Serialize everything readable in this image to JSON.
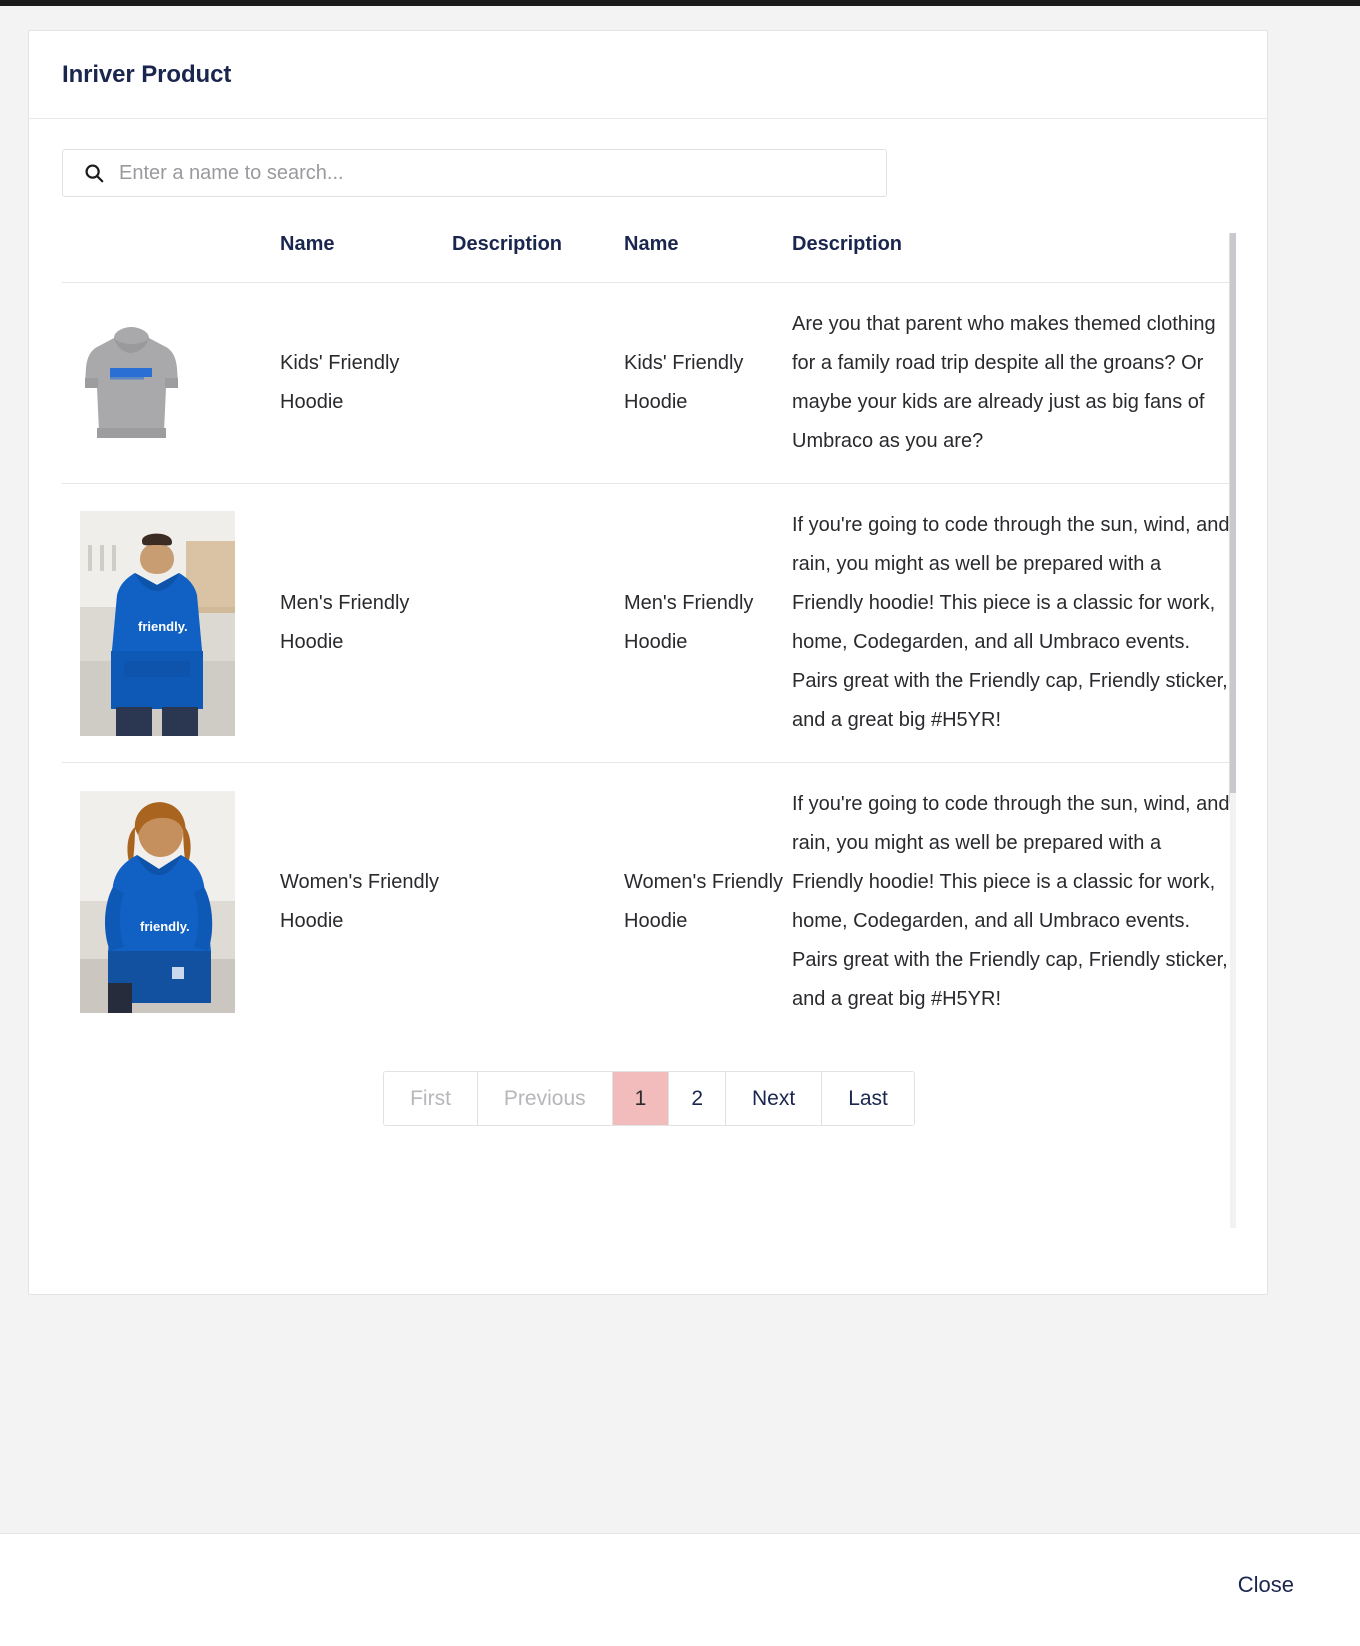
{
  "window": {
    "title": "Inriver Product"
  },
  "search": {
    "placeholder": "Enter a name to search...",
    "value": "",
    "icon": "search-icon"
  },
  "table": {
    "headers": [
      "Name",
      "Description",
      "Name",
      "Description"
    ],
    "rows": [
      {
        "image_alt": "Kids' Friendly Hoodie",
        "name1": "Kids' Friendly Hoodie",
        "description1": "",
        "name2": "Kids' Friendly Hoodie",
        "description2": "Are you that parent who makes themed clothing for a family road trip despite all the groans? Or maybe your kids are already just as big fans of Umbraco as you are?"
      },
      {
        "image_alt": "Men's Friendly Hoodie",
        "name1": "Men's Friendly Hoodie",
        "description1": "",
        "name2": "Men's Friendly Hoodie",
        "description2": "If you're going to code through the sun, wind, and rain, you might as well be prepared with a Friendly hoodie! This piece is a classic for work, home, Codegarden, and all Umbraco events. Pairs great with the Friendly cap, Friendly sticker, and a great big #H5YR!"
      },
      {
        "image_alt": "Women's Friendly Hoodie",
        "name1": "Women's Friendly Hoodie",
        "description1": "",
        "name2": "Women's Friendly Hoodie",
        "description2": "If you're going to code through the sun, wind, and rain, you might as well be prepared with a Friendly hoodie! This piece is a classic for work, home, Codegarden, and all Umbraco events. Pairs great with the Friendly cap, Friendly sticker, and a great big #H5YR!"
      }
    ]
  },
  "pagination": {
    "first": "First",
    "previous": "Previous",
    "page_1": "1",
    "page_2": "2",
    "next": "Next",
    "last": "Last",
    "active_page": "1",
    "active_color": "#f3bcbc",
    "disabled_color": "#b7b7bb"
  },
  "footer": {
    "close": "Close"
  },
  "colors": {
    "panel_background": "#ffffff",
    "page_background": "#f4f3f4",
    "text": "#1b264f",
    "brand_blue": "#0d6fd1"
  }
}
